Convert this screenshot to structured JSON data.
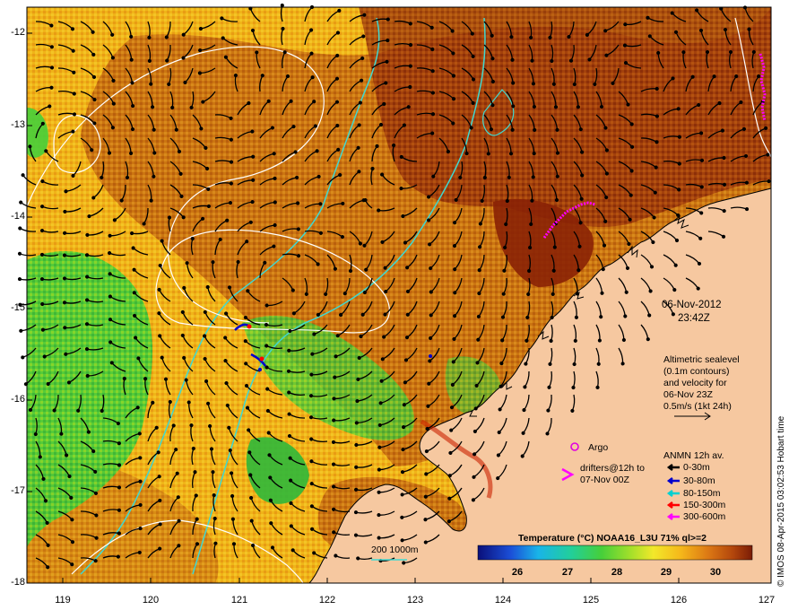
{
  "map": {
    "date": "06-Nov-2012",
    "time": "23:42Z",
    "altimetry_note": [
      "Altimetric sealevel",
      "(0.1m contours)",
      "and velocity for",
      "06-Nov 23Z",
      "0.5m/s (1kt 24h)"
    ],
    "argo_label": "Argo",
    "drifters_label": [
      "drifters@12h to",
      "07-Nov 00Z"
    ],
    "anmn_title": "ANMN 12h av.",
    "anmn_depths": [
      {
        "label": "0-30m",
        "color": "#000000"
      },
      {
        "label": "30-80m",
        "color": "#0000cc"
      },
      {
        "label": "80-150m",
        "color": "#00d0d0"
      },
      {
        "label": "150-300m",
        "color": "#ff0000"
      },
      {
        "label": "300-600m",
        "color": "#ff00ff"
      }
    ],
    "bathymetry_label": "200  1000m",
    "colorbar_title": "Temperature (°C) NOAA16_L3U 71% ql>=2",
    "colorbar_ticks": [
      "26",
      "27",
      "28",
      "29",
      "30"
    ],
    "y_ticks": [
      "-12",
      "-13",
      "-14",
      "-15",
      "-16",
      "-17",
      "-18"
    ],
    "x_ticks": [
      "119",
      "120",
      "121",
      "122",
      "123",
      "124",
      "125",
      "126",
      "127"
    ],
    "credit": "© IMOS 08-Apr-2015 03:02:53 Hobart time",
    "colors": {
      "land": "#f6c8a0",
      "warm": "#b85a0a",
      "hot": "#8a2a06",
      "mid": "#f0c020",
      "cool": "#3fd43f",
      "cyan_contour": "#40d8d0",
      "argo": "#e000e0"
    }
  }
}
